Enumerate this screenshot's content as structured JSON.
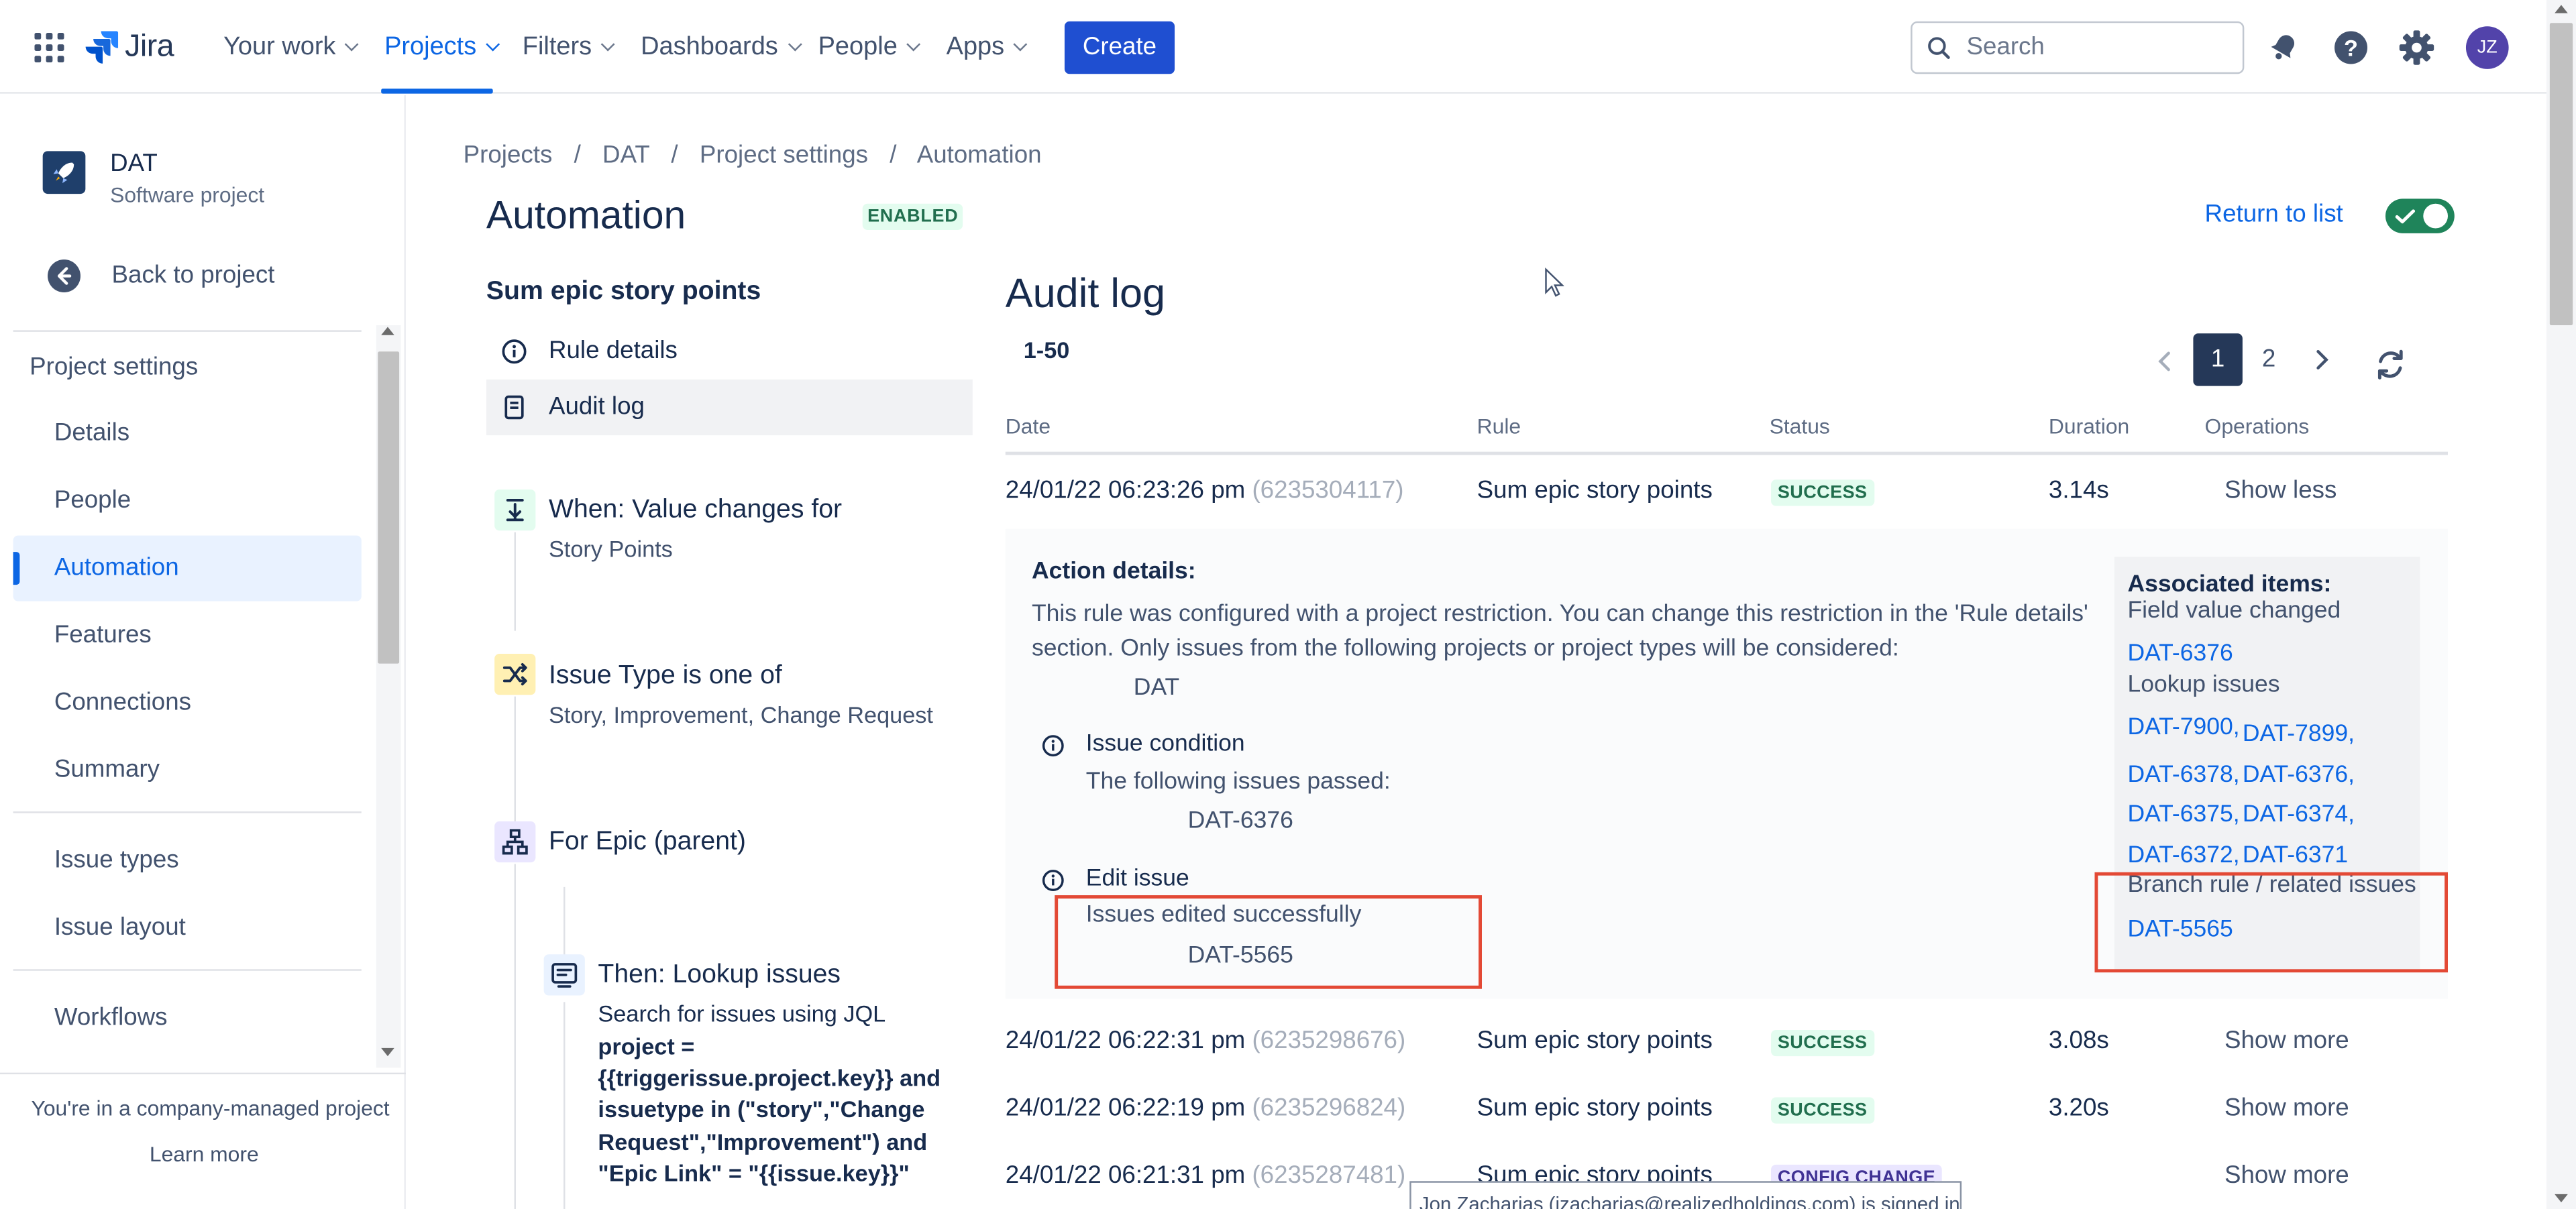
{
  "topnav": {
    "logo_text": "Jira",
    "items": [
      {
        "label": "Your work"
      },
      {
        "label": "Projects"
      },
      {
        "label": "Filters"
      },
      {
        "label": "Dashboards"
      },
      {
        "label": "People"
      },
      {
        "label": "Apps"
      }
    ],
    "create_label": "Create",
    "search_placeholder": "Search",
    "avatar_initials": "JZ"
  },
  "sidebar": {
    "project_name": "DAT",
    "project_type": "Software project",
    "back_label": "Back to project",
    "section_title": "Project settings",
    "items": [
      {
        "label": "Details"
      },
      {
        "label": "People"
      },
      {
        "label": "Automation"
      },
      {
        "label": "Features"
      },
      {
        "label": "Connections"
      },
      {
        "label": "Summary"
      },
      {
        "label": "Issue types"
      },
      {
        "label": "Issue layout"
      },
      {
        "label": "Workflows"
      }
    ],
    "footer_text": "You're in a company-managed project",
    "footer_link": "Learn more"
  },
  "breadcrumbs": [
    "Projects",
    "DAT",
    "Project settings",
    "Automation"
  ],
  "page": {
    "title": "Automation",
    "status_badge": "ENABLED",
    "return_label": "Return to list",
    "toggle_on": true
  },
  "rule": {
    "name": "Sum epic story points",
    "nav": [
      "Rule details",
      "Audit log"
    ],
    "components": [
      {
        "title": "When: Value changes for",
        "sub": "Story Points"
      },
      {
        "title": "Issue Type is one of",
        "sub": "Story, Improvement, Change Request"
      },
      {
        "title": "For Epic (parent)",
        "sub": ""
      },
      {
        "title": "Then: Lookup issues",
        "sub": "Search for issues using JQL"
      }
    ],
    "jql": "project = {{triggerissue.project.key}} and issuetype in (\"story\",\"Change Request\",\"Improvement\") and \"Epic Link\" = \"{{issue.key}}\""
  },
  "audit": {
    "title": "Audit log",
    "range": "1-50",
    "pages": [
      "1",
      "2"
    ],
    "current_page": "1",
    "columns": [
      "Date",
      "Rule",
      "Status",
      "Duration",
      "Operations"
    ],
    "rows": [
      {
        "date": "24/01/22 06:23:26 pm",
        "id": "(6235304117)",
        "rule": "Sum epic story points",
        "status": "SUCCESS",
        "duration": "3.14s",
        "op": "Show less"
      },
      {
        "date": "24/01/22 06:22:31 pm",
        "id": "(6235298676)",
        "rule": "Sum epic story points",
        "status": "SUCCESS",
        "duration": "3.08s",
        "op": "Show more"
      },
      {
        "date": "24/01/22 06:22:19 pm",
        "id": "(6235296824)",
        "rule": "Sum epic story points",
        "status": "SUCCESS",
        "duration": "3.20s",
        "op": "Show more"
      },
      {
        "date": "24/01/22 06:21:31 pm",
        "id": "(6235287481)",
        "rule": "Sum epic story points",
        "status": "CONFIG CHANGE",
        "duration": "",
        "op": "Show more"
      }
    ],
    "details": {
      "heading": "Action details:",
      "restriction_line1": "This rule was configured with a project restriction. You can change this restriction in the 'Rule details'",
      "restriction_line2": "section. Only issues from the following projects or project types will be considered:",
      "restriction_project": "DAT",
      "condition_title": "Issue condition",
      "condition_text": "The following issues passed:",
      "condition_issue": "DAT-6376",
      "edit_title": "Edit issue",
      "edit_text": "Issues edited successfully",
      "edit_issue": "DAT-5565"
    },
    "associated": {
      "heading": "Associated items:",
      "field_changed_label": "Field value changed",
      "field_changed_issue": "DAT-6376",
      "lookup_label": "Lookup issues",
      "lookup_issues": [
        "DAT-7900,",
        "DAT-7899,",
        "DAT-6378,",
        "DAT-6376,",
        "DAT-6375,",
        "DAT-6374,",
        "DAT-6372,",
        "DAT-6371"
      ],
      "branch_label": "Branch rule / related issues",
      "branch_issue": "DAT-5565"
    }
  },
  "tooltip": "Jon Zacharias (jzacharias@realizedholdings.com) is signed in",
  "colors": {
    "brand": "#0c66e4",
    "create_button": "#1f4fd1",
    "success_bg": "#e3fcef",
    "success_text": "#216e4e",
    "config_bg": "#eae6ff",
    "highlight_border": "#e34935",
    "toggle_on": "#1f845a"
  },
  "icons": {
    "app_switcher": "grid-icon",
    "notifications": "bell-icon",
    "help": "question-icon",
    "settings": "gear-icon",
    "refresh": "refresh-icon"
  }
}
